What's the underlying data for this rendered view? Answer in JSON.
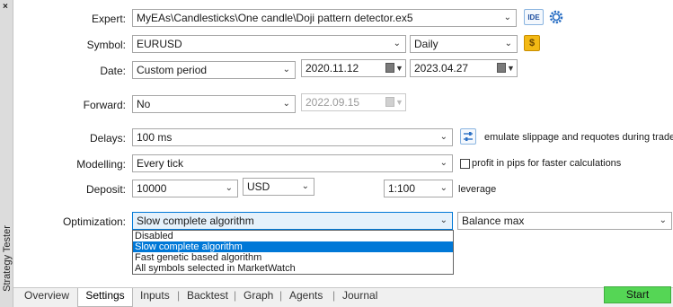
{
  "window": {
    "sidebar_title": "Strategy Tester",
    "close_glyph": "×"
  },
  "form": {
    "expert": {
      "label": "Expert:",
      "value": "MyEAs\\Candlesticks\\One candle\\Doji pattern detector.ex5",
      "ide_label": "IDE"
    },
    "symbol": {
      "label": "Symbol:",
      "value": "EURUSD",
      "timeframe": "Daily",
      "coin_glyph": "$"
    },
    "date": {
      "label": "Date:",
      "mode": "Custom period",
      "from": "2020.11.12",
      "to": "2023.04.27"
    },
    "forward": {
      "label": "Forward:",
      "mode": "No",
      "date": "2022.09.15"
    },
    "delays": {
      "label": "Delays:",
      "value": "100 ms",
      "note": "emulate slippage and requotes during trade e"
    },
    "modelling": {
      "label": "Modelling:",
      "value": "Every tick",
      "checkbox_label": "profit in pips for faster calculations",
      "checked": false
    },
    "deposit": {
      "label": "Deposit:",
      "amount": "10000",
      "currency": "USD",
      "leverage": "1:100",
      "leverage_label": "leverage"
    },
    "optimization": {
      "label": "Optimization:",
      "value": "Slow complete algorithm",
      "criterion": "Balance max",
      "options": [
        "Disabled",
        "Slow complete algorithm",
        "Fast genetic based algorithm",
        "All symbols selected in MarketWatch"
      ],
      "selected_option": "Slow complete algorithm"
    }
  },
  "tabs": {
    "items": [
      "Overview",
      "Settings",
      "Inputs",
      "Backtest",
      "Graph",
      "Agents",
      "Journal"
    ],
    "active": "Settings",
    "separator": "|"
  },
  "actions": {
    "start_label": "Start"
  },
  "colors": {
    "accent": "#0078d7",
    "start": "#55d655",
    "panel": "#ffffff"
  }
}
